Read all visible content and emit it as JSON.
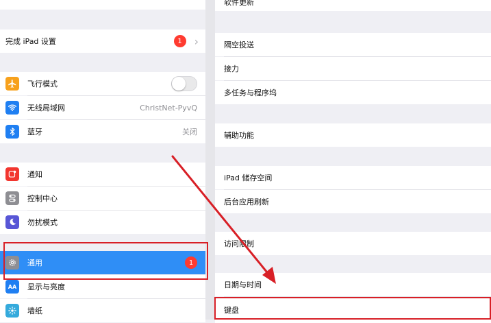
{
  "sidebar": {
    "finish_setup": {
      "label": "完成 iPad 设置",
      "badge": "1"
    },
    "airplane": {
      "label": "飞行模式"
    },
    "wifi": {
      "label": "无线局域网",
      "value": "ChristNet-PyvQ"
    },
    "bluetooth": {
      "label": "蓝牙",
      "value": "关闭"
    },
    "notifications": {
      "label": "通知"
    },
    "control_center": {
      "label": "控制中心"
    },
    "dnd": {
      "label": "勿扰模式"
    },
    "general": {
      "label": "通用",
      "badge": "1"
    },
    "display": {
      "label": "显示与亮度"
    },
    "wallpaper": {
      "label": "墙纸"
    }
  },
  "detail": {
    "software_update": "软件更新",
    "airdrop": "隔空投送",
    "handoff": "接力",
    "multitasking": "多任务与程序坞",
    "accessibility": "辅助功能",
    "storage": "iPad 储存空间",
    "background_refresh": "后台应用刷新",
    "restrictions": "访问限制",
    "date_time": "日期与时间",
    "keyboard": "键盘"
  },
  "colors": {
    "accent": "#2f8ef6",
    "badge": "#ff3b30",
    "annotation": "#d81f26"
  },
  "icons": {
    "airplane": "airplane-icon",
    "wifi": "wifi-icon",
    "bluetooth": "bluetooth-icon",
    "notifications": "notifications-icon",
    "control_center": "control-center-icon",
    "dnd": "moon-icon",
    "general": "gear-icon",
    "display": "display-icon",
    "wallpaper": "wallpaper-icon"
  }
}
